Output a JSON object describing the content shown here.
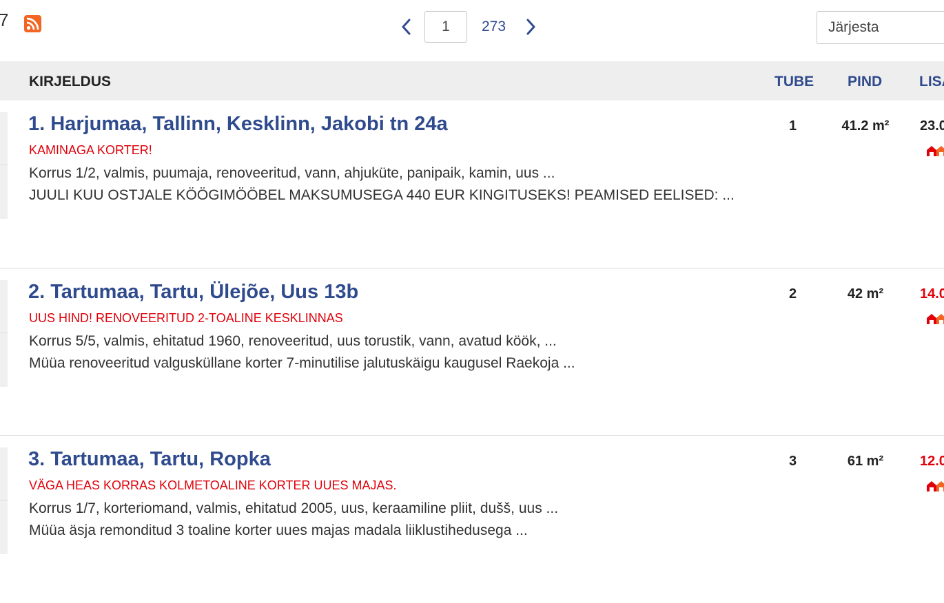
{
  "header": {
    "results_count_visible": "7",
    "rss_icon": "rss-icon",
    "pagination": {
      "current_page": "1",
      "total_pages": "273",
      "prev_icon": "chevron-left-icon",
      "next_icon": "chevron-right-icon"
    },
    "sort": {
      "selected": "Järjesta"
    }
  },
  "table": {
    "columns": {
      "description": "KIRJELDUS",
      "rooms": "TUBE",
      "area": "PIND",
      "added": "LISA"
    },
    "rows": [
      {
        "title": "1. Harjumaa, Tallinn, Kesklinn, Jakobi tn 24a",
        "slogan": "KAMINAGA KORTER!",
        "line1": "Korrus 1/2, valmis, puumaja, renoveeritud, vann, ahjuküte, panipaik, kamin, uus ...",
        "line2": "JUULI KUU OSTJALE KÖÖGIMÖÖBEL MAKSUMUSEGA 440 EUR KINGITUSEKS! PEAMISED EELISED: ...",
        "rooms": "1",
        "area": "41.2 m²",
        "date": "23.0",
        "date_color": "#222222"
      },
      {
        "title": "2. Tartumaa, Tartu, Ülejõe, Uus 13b",
        "slogan": "UUS HIND! RENOVEERITUD 2-TOALINE KESKLINNAS",
        "line1": "Korrus 5/5, valmis, ehitatud 1960, renoveeritud, uus torustik, vann, avatud köök, ...",
        "line2": "Müüa renoveeritud valgusküllane korter 7-minutilise jalutuskäigu kaugusel Raekoja ...",
        "rooms": "2",
        "area": "42 m²",
        "date": "14.0",
        "date_color": "#e0000a"
      },
      {
        "title": "3. Tartumaa, Tartu, Ropka",
        "slogan": "VÄGA HEAS KORRAS KOLMETOALINE KORTER UUES MAJAS.",
        "line1": "Korrus 1/7, korteriomand, valmis, ehitatud 2005, uus, keraamiline pliit, dušš, uus ...",
        "line2": "Müüa äsja remonditud 3 toaline korter uues majas madala liiklustihedusega ...",
        "rooms": "3",
        "area": "61 m²",
        "date": "12.0",
        "date_color": "#e0000a"
      }
    ]
  },
  "colors": {
    "brand_blue": "#2f4b8e",
    "slogan_red": "#e0000a",
    "rss_orange": "#f26522",
    "header_bg": "#eeeeee"
  },
  "icons": {
    "house_badge": "house-icon"
  }
}
